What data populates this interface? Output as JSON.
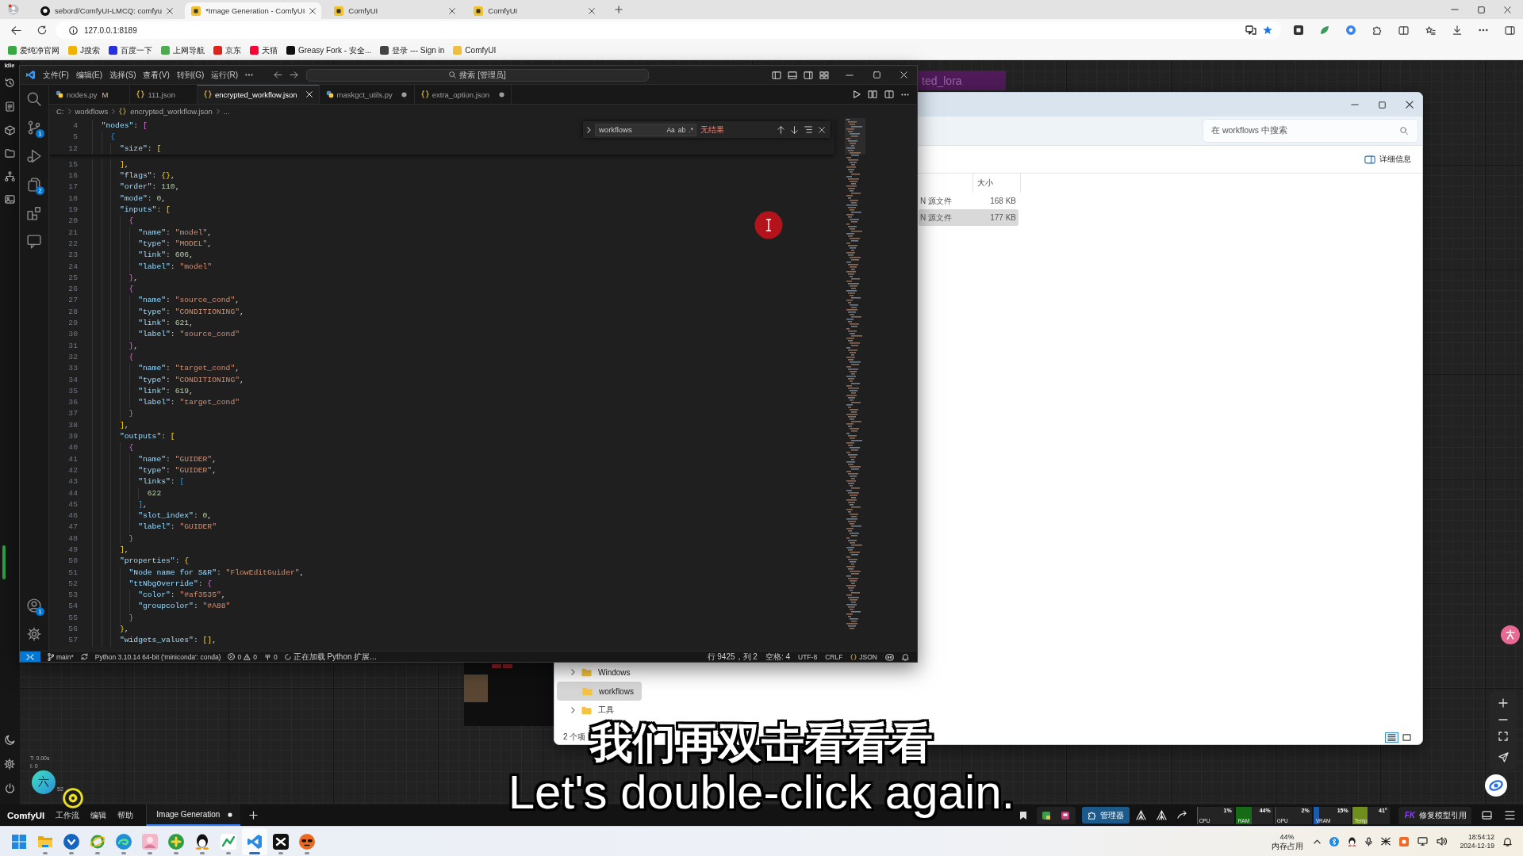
{
  "browser": {
    "tabs": [
      {
        "kind": "github",
        "title": "sebord/ComfyUI-LMCQ: comfyu",
        "selected": false
      },
      {
        "kind": "comfyui",
        "title": "*Image Generation - ComfyUI",
        "selected": true
      },
      {
        "kind": "comfyui",
        "title": "ComfyUI",
        "selected": false
      },
      {
        "kind": "comfyui",
        "title": "ComfyUI",
        "selected": false
      }
    ],
    "address": "127.0.0.1:8189",
    "bookmarks": [
      {
        "label": "爱纯净官网",
        "color": "#3aa845"
      },
      {
        "label": "J搜索",
        "color": "#f2b400"
      },
      {
        "label": "百度一下",
        "color": "#2932e1"
      },
      {
        "label": "上网导航",
        "color": "#4caf50"
      },
      {
        "label": "京东",
        "color": "#e1251b"
      },
      {
        "label": "天猫",
        "color": "#ff0036"
      },
      {
        "label": "Greasy Fork - 安全...",
        "color": "#111111"
      },
      {
        "label": "登录 --- Sign in",
        "color": "#444444"
      },
      {
        "label": "ComfyUI",
        "color": "#f0c040"
      }
    ]
  },
  "comfyui": {
    "status": "Idle",
    "stats": [
      "T: 0.00s",
      "I: 0",
      "52"
    ],
    "avatar": "六",
    "node_title": "ted_lora",
    "brand": "ComfyUI",
    "menu": [
      "工作流",
      "编辑",
      "帮助"
    ],
    "workflow_tab": {
      "title": "Image Generation",
      "selected": true,
      "modified": true
    },
    "manager_button": "管理器",
    "monitors": [
      {
        "label": "CPU",
        "value": "1%",
        "level": 0.01,
        "color": "#2e7d32"
      },
      {
        "label": "RAM",
        "value": "44%",
        "level": 0.44,
        "color": "#176b17"
      },
      {
        "label": "GPU",
        "value": "2%",
        "level": 0.02,
        "color": "#1e5aa8"
      },
      {
        "label": "VRAM",
        "value": "15%",
        "level": 0.15,
        "color": "#1e5aa8"
      },
      {
        "label": "Temp",
        "value": "41°",
        "level": 0.41,
        "color": "#6e8e1e"
      }
    ],
    "fix_button": {
      "badge": "FK",
      "label": "修复模型引用"
    }
  },
  "vscode": {
    "menu": [
      "文件(F)",
      "编辑(E)",
      "选择(S)",
      "查看(V)",
      "转到(G)",
      "运行(R)"
    ],
    "command_center": "搜索 [管理员]",
    "activity": [
      {
        "kind": "search"
      },
      {
        "kind": "source-control",
        "badge": "1"
      },
      {
        "kind": "run"
      },
      {
        "kind": "copy",
        "badge": "2"
      },
      {
        "kind": "extensions"
      },
      {
        "kind": "chat"
      }
    ],
    "activity_bottom": [
      {
        "kind": "account",
        "badge": "1"
      },
      {
        "kind": "settings"
      }
    ],
    "tabs": [
      {
        "kind": "python",
        "label": "nodes.py",
        "git_status": "M",
        "selected": false,
        "modified": false
      },
      {
        "kind": "json",
        "label": "111.json",
        "selected": false,
        "modified": false
      },
      {
        "kind": "json",
        "label": "encrypted_workflow.json",
        "selected": true,
        "modified": false
      },
      {
        "kind": "python",
        "label": "maskgct_utils.py",
        "selected": false,
        "modified": true
      },
      {
        "kind": "json",
        "label": "extra_option.json",
        "selected": false,
        "modified": true
      }
    ],
    "breadcrumb": [
      {
        "kind": "folder",
        "label": "C:"
      },
      {
        "kind": "folder",
        "label": "workflows"
      },
      {
        "kind": "json",
        "label": "encrypted_workflow.json"
      },
      {
        "kind": "symbol",
        "label": "..."
      }
    ],
    "find": {
      "value": "workflows",
      "options": [
        "Aa",
        "ab",
        ".*"
      ],
      "result": "无结果"
    },
    "sticky_lines": [
      {
        "number": "4",
        "text": "  \"nodes\": ["
      },
      {
        "number": "5",
        "text": "    {"
      },
      {
        "number": "12",
        "text": "      \"size\": ["
      }
    ],
    "lines": [
      {
        "number": "15",
        "text": "      ],"
      },
      {
        "number": "16",
        "text": "      \"flags\": {},"
      },
      {
        "number": "17",
        "text": "      \"order\": 110,"
      },
      {
        "number": "18",
        "text": "      \"mode\": 0,"
      },
      {
        "number": "19",
        "text": "      \"inputs\": ["
      },
      {
        "number": "20",
        "text": "        {"
      },
      {
        "number": "21",
        "text": "          \"name\": \"model\","
      },
      {
        "number": "22",
        "text": "          \"type\": \"MODEL\","
      },
      {
        "number": "23",
        "text": "          \"link\": 606,"
      },
      {
        "number": "24",
        "text": "          \"label\": \"model\""
      },
      {
        "number": "25",
        "text": "        },"
      },
      {
        "number": "26",
        "text": "        {"
      },
      {
        "number": "27",
        "text": "          \"name\": \"source_cond\","
      },
      {
        "number": "28",
        "text": "          \"type\": \"CONDITIONING\","
      },
      {
        "number": "29",
        "text": "          \"link\": 621,"
      },
      {
        "number": "30",
        "text": "          \"label\": \"source_cond\""
      },
      {
        "number": "31",
        "text": "        },"
      },
      {
        "number": "32",
        "text": "        {"
      },
      {
        "number": "33",
        "text": "          \"name\": \"target_cond\","
      },
      {
        "number": "34",
        "text": "          \"type\": \"CONDITIONING\","
      },
      {
        "number": "35",
        "text": "          \"link\": 619,"
      },
      {
        "number": "36",
        "text": "          \"label\": \"target_cond\""
      },
      {
        "number": "37",
        "text": "        }"
      },
      {
        "number": "38",
        "text": "      ],"
      },
      {
        "number": "39",
        "text": "      \"outputs\": ["
      },
      {
        "number": "40",
        "text": "        {"
      },
      {
        "number": "41",
        "text": "          \"name\": \"GUIDER\","
      },
      {
        "number": "42",
        "text": "          \"type\": \"GUIDER\","
      },
      {
        "number": "43",
        "text": "          \"links\": ["
      },
      {
        "number": "44",
        "text": "            622"
      },
      {
        "number": "45",
        "text": "          ],"
      },
      {
        "number": "46",
        "text": "          \"slot_index\": 0,"
      },
      {
        "number": "47",
        "text": "          \"label\": \"GUIDER\""
      },
      {
        "number": "48",
        "text": "        }"
      },
      {
        "number": "49",
        "text": "      ],"
      },
      {
        "number": "50",
        "text": "      \"properties\": {"
      },
      {
        "number": "51",
        "text": "        \"Node name for S&R\": \"FlowEditGuider\","
      },
      {
        "number": "52",
        "text": "        \"ttNbgOverride\": {"
      },
      {
        "number": "53",
        "text": "          \"color\": \"#af3535\","
      },
      {
        "number": "54",
        "text": "          \"groupcolor\": \"#A88\""
      },
      {
        "number": "55",
        "text": "        }"
      },
      {
        "number": "56",
        "text": "      },"
      },
      {
        "number": "57",
        "text": "      \"widgets_values\": [],"
      }
    ],
    "status_bar": {
      "branch": "main*",
      "interpreter": "Python 3.10.14 64-bit ('miniconda': conda)",
      "errors": "0",
      "warnings": "0",
      "ports": "0",
      "loading": "正在加载 Python 扩展...",
      "position": "行 9425，列 2",
      "indent": "空格: 4",
      "encoding": "UTF-8",
      "eol": "CRLF",
      "language": "JSON"
    }
  },
  "explorer": {
    "search_placeholder": "在 workflows 中搜索",
    "details_button": "详细信息",
    "size_column": "大小",
    "rows": [
      {
        "type": "N 源文件",
        "size": "168 KB",
        "selected": false
      },
      {
        "type": "N 源文件",
        "size": "177 KB",
        "selected": true
      }
    ],
    "nav": [
      {
        "label": "Windows",
        "expandable": true,
        "selected": false
      },
      {
        "label": "workflows",
        "expandable": false,
        "selected": true
      },
      {
        "label": "工具",
        "expandable": true,
        "selected": false
      }
    ],
    "status": [
      "2 个项"
    ],
    "views": [
      {
        "kind": "details",
        "selected": true
      },
      {
        "kind": "tiles",
        "selected": false
      }
    ]
  },
  "subtitles": [
    "我们再双击看看看",
    "Let's double-click again."
  ],
  "taskbar": {
    "apps": [
      {
        "kind": "files",
        "running": true,
        "selected": false
      },
      {
        "kind": "v",
        "running": true,
        "selected": false
      },
      {
        "kind": "ie",
        "running": true,
        "selected": false
      },
      {
        "kind": "edge",
        "running": true,
        "selected": false
      },
      {
        "kind": "picture",
        "running": true,
        "selected": false
      },
      {
        "kind": "green",
        "running": true,
        "selected": false
      },
      {
        "kind": "qq",
        "running": true,
        "selected": false
      },
      {
        "kind": "chart",
        "running": true,
        "selected": false
      },
      {
        "kind": "vscode",
        "running": true,
        "selected": true
      },
      {
        "kind": "capcut",
        "running": true,
        "selected": false
      },
      {
        "kind": "face",
        "running": true,
        "selected": false
      }
    ],
    "memory": {
      "value": "44%",
      "label": "内存占用"
    },
    "time": "18:54:12",
    "date": "2024-12-19"
  }
}
